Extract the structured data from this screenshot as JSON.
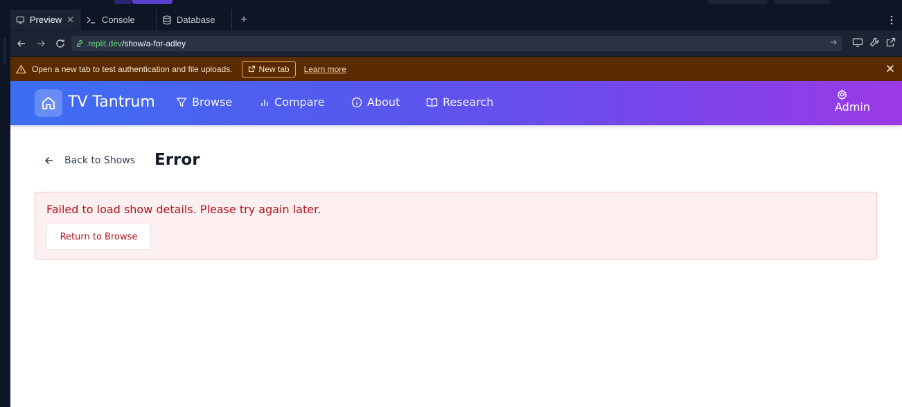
{
  "tabs": [
    {
      "label": "Preview",
      "icon": "monitor-icon",
      "active": true
    },
    {
      "label": "Console",
      "icon": "terminal-icon",
      "active": false
    },
    {
      "label": "Database",
      "icon": "database-icon",
      "active": false
    }
  ],
  "address": {
    "domain": ".replit.dev",
    "path": "/show/a-for-adley"
  },
  "banner": {
    "message": "Open a new tab to test authentication and file uploads.",
    "new_tab_label": "New tab",
    "learn_more_label": "Learn more"
  },
  "app": {
    "brand": "TV Tantrum",
    "nav": [
      {
        "label": "Browse",
        "icon": "filter-icon"
      },
      {
        "label": "Compare",
        "icon": "bar-chart-icon"
      },
      {
        "label": "About",
        "icon": "info-icon"
      },
      {
        "label": "Research",
        "icon": "book-icon"
      }
    ],
    "admin_label": "Admin",
    "back_label": "Back to Shows",
    "page_title": "Error",
    "error_message": "Failed to load show details. Please try again later.",
    "return_label": "Return to Browse"
  },
  "colors": {
    "header_gradient_start": "#3b6ff3",
    "header_gradient_end": "#9b3ae6",
    "error_text": "#b3121c",
    "error_bg": "#fef0f0",
    "banner_bg": "#5a2b00"
  }
}
